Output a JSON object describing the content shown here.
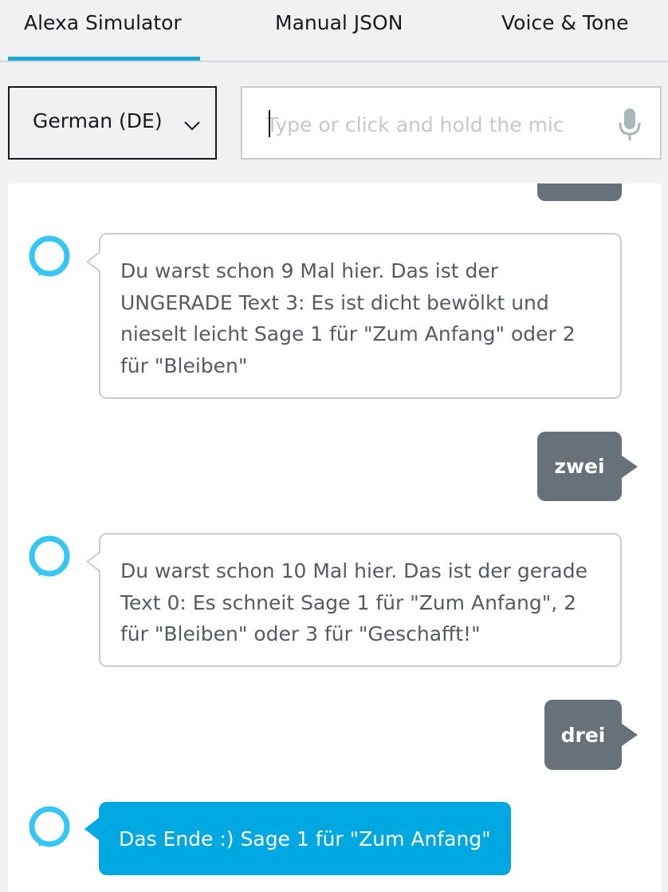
{
  "tabs": [
    {
      "label": "Alexa Simulator",
      "active": true
    },
    {
      "label": "Manual JSON",
      "active": false
    },
    {
      "label": "Voice & Tone",
      "active": false
    }
  ],
  "language": {
    "selected": "German (DE)"
  },
  "utterance": {
    "placeholder": "Type or click and hold the mic",
    "value": ""
  },
  "conversation": {
    "alexa_1": "Du warst schon 9 Mal hier. Das ist der UNGERADE Text 3: Es ist dicht bewölkt und nieselt leicht Sage 1 für \"Zum Anfang\" oder 2 für \"Bleiben\"",
    "user_1": "zwei",
    "alexa_2": "Du warst schon 10 Mal hier. Das ist der gerade Text 0: Es schneit Sage 1 für \"Zum Anfang\", 2 für \"Bleiben\" oder 3 für \"Geschafft!\"",
    "user_2": "drei",
    "alexa_3": "Das Ende :) Sage 1 für \"Zum Anfang\""
  },
  "colors": {
    "accent": "#1aa7db",
    "alexa_bubble": "#00a8e1",
    "user_bubble": "#687078",
    "avatar_ring": "#37c6f4"
  },
  "icons": [
    "chevron-down-icon",
    "microphone-icon",
    "alexa-ring-icon"
  ]
}
